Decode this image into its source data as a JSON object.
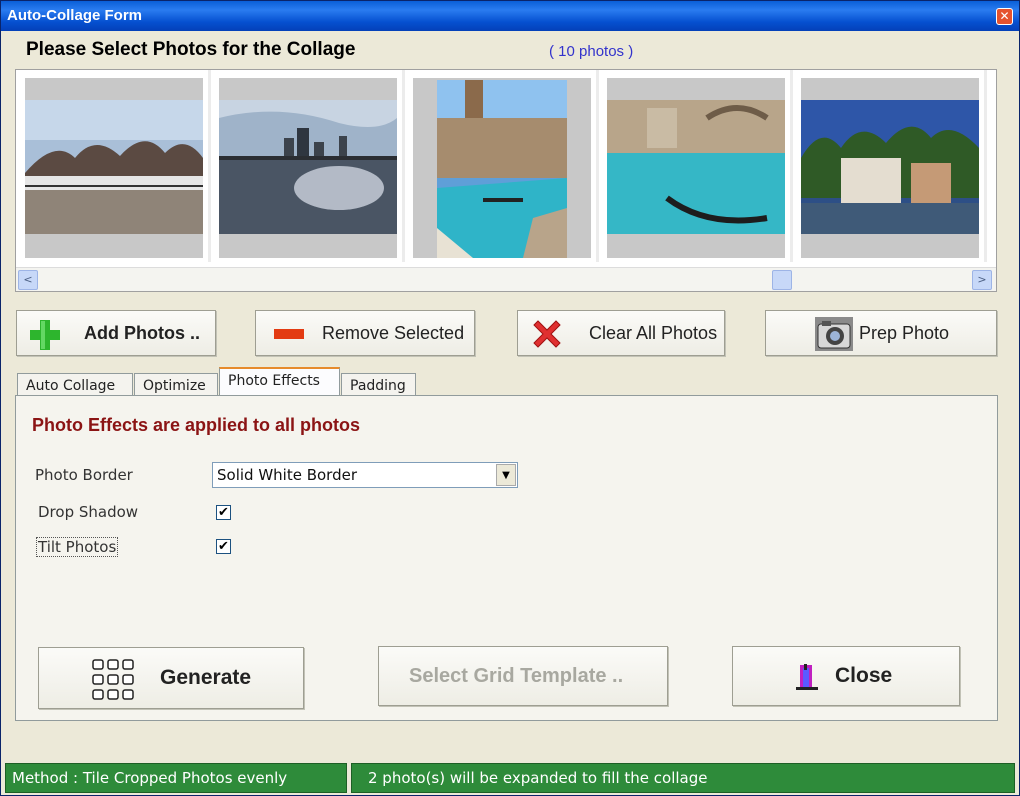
{
  "window": {
    "title": "Auto-Collage Form",
    "close_glyph": "✕"
  },
  "header": {
    "title": "Please Select Photos for the Collage",
    "photo_count": "( 10 photos )"
  },
  "gallery": {
    "scroll_left": "<",
    "scroll_right": ">"
  },
  "toolbar": {
    "add_photos": "Add Photos ..",
    "remove_selected": "Remove Selected",
    "clear_all": "Clear All Photos",
    "prep_photo": "Prep Photo"
  },
  "tabs": [
    {
      "label": "Auto Collage"
    },
    {
      "label": "Optimize"
    },
    {
      "label": "Photo Effects"
    },
    {
      "label": "Padding"
    }
  ],
  "effects": {
    "heading": "Photo Effects are applied to all photos",
    "photo_border_label": "Photo Border",
    "photo_border_value": "Solid White Border",
    "drop_shadow_label": "Drop Shadow",
    "drop_shadow_checked": true,
    "tilt_photos_label": "Tilt Photos",
    "tilt_photos_checked": true,
    "check_glyph": "✔"
  },
  "actions": {
    "generate": "Generate",
    "select_grid_template": "Select Grid Template ..",
    "close": "Close"
  },
  "status": {
    "method": "Method : Tile Cropped Photos evenly",
    "expand_note": "2 photo(s) will be expanded to fill the collage"
  },
  "colors": {
    "title_red": "#8b1414",
    "status_green": "#2e8b3a",
    "count_blue": "#3333cc"
  }
}
